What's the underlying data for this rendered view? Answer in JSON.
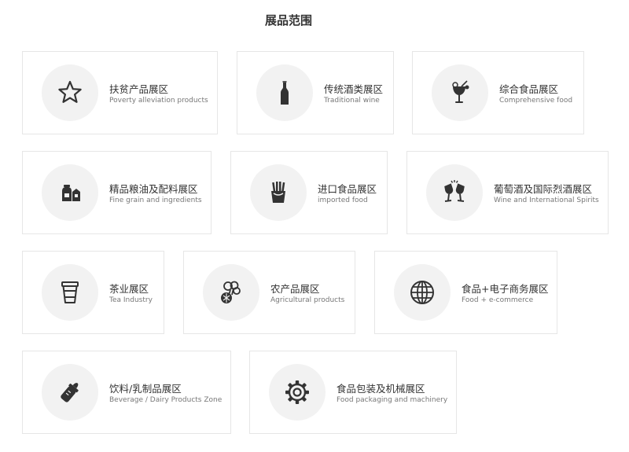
{
  "page": {
    "title": "展品范围"
  },
  "categories": [
    {
      "title": "扶贫产品展区",
      "subtitle": "Poverty alleviation products",
      "icon": "star-icon"
    },
    {
      "title": "传统酒类展区",
      "subtitle": "Traditional wine",
      "icon": "wine-bottle-icon"
    },
    {
      "title": "综合食品展区",
      "subtitle": "Comprehensive food",
      "icon": "cocktail-icon"
    },
    {
      "title": "精品粮油及配料展区",
      "subtitle": "Fine grain and ingredients",
      "icon": "grain-bag-icon"
    },
    {
      "title": "进口食品展区",
      "subtitle": "imported food",
      "icon": "fries-icon"
    },
    {
      "title": "葡萄酒及国际烈酒展区",
      "subtitle": "Wine and International Spirits",
      "icon": "wine-glasses-icon"
    },
    {
      "title": "茶业展区",
      "subtitle": "Tea Industry",
      "icon": "tea-cup-icon"
    },
    {
      "title": "农产品展区",
      "subtitle": "Agricultural products",
      "icon": "produce-icon"
    },
    {
      "title": "食品+电子商务展区",
      "subtitle": "Food + e-commerce",
      "icon": "globe-icon"
    },
    {
      "title": "饮料/乳制品展区",
      "subtitle": "Beverage / Dairy Products Zone",
      "icon": "baby-bottle-icon"
    },
    {
      "title": "食品包装及机械展区",
      "subtitle": "Food packaging and machinery",
      "icon": "gear-icon"
    }
  ]
}
